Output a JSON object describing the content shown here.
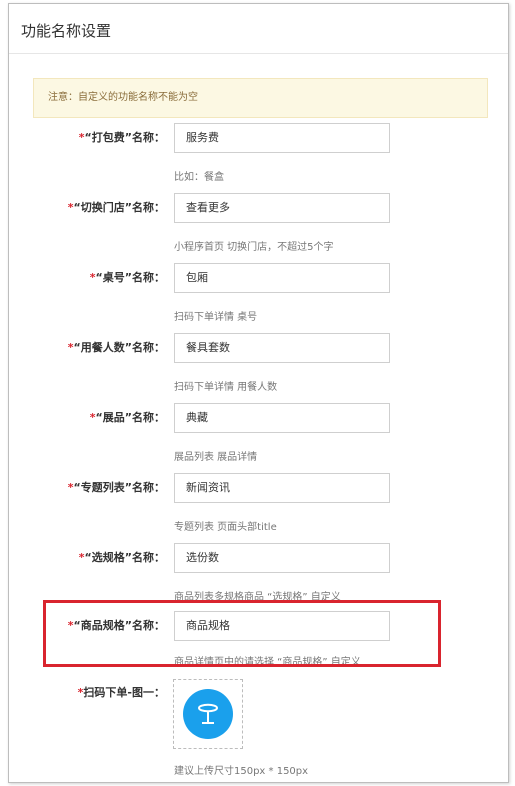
{
  "page": {
    "title": "功能名称设置",
    "notice": "注意：自定义的功能名称不能为空"
  },
  "fields": [
    {
      "label": "“打包费”名称：",
      "value": "服务费",
      "hint": "比如：餐盒"
    },
    {
      "label": "“切换门店”名称：",
      "value": "查看更多",
      "hint": "小程序首页 切换门店，不超过5个字"
    },
    {
      "label": "“桌号”名称：",
      "value": "包厢",
      "hint": "扫码下单详情 桌号"
    },
    {
      "label": "“用餐人数”名称：",
      "value": "餐具套数",
      "hint": "扫码下单详情 用餐人数"
    },
    {
      "label": "“展品”名称：",
      "value": "典藏",
      "hint": "展品列表 展品详情"
    },
    {
      "label": "“专题列表”名称：",
      "value": "新闻资讯",
      "hint": "专题列表 页面头部title"
    },
    {
      "label": "“选规格”名称：",
      "value": "选份数",
      "hint": "商品列表多规格商品 “选规格” 自定义"
    },
    {
      "label": "“商品规格”名称：",
      "value": "商品规格",
      "hint": "商品详情页中的请选择 “商品规格” 自定义"
    }
  ],
  "upload": {
    "label": "扫码下单-图一：",
    "icon": "table-icon",
    "hint": "建议上传尺寸150px * 150px"
  },
  "colors": {
    "required_star": "#d9242e",
    "highlight_box": "#d9242e",
    "notice_bg": "#fcf8e3",
    "upload_icon_bg": "#1aa0ec"
  }
}
